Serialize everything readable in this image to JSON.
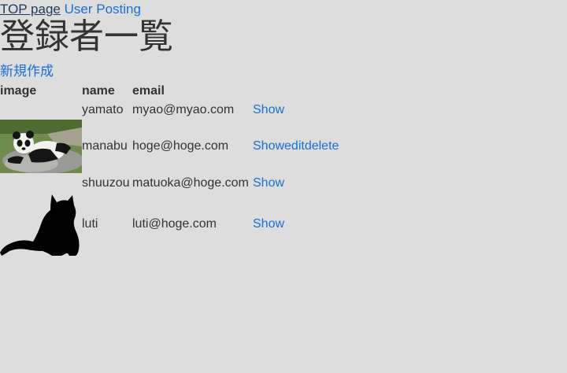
{
  "nav": {
    "top_label": "TOP page",
    "posting_label": "User Posting"
  },
  "page_title": "登録者一覧",
  "new_label": "新規作成",
  "table": {
    "headers": [
      "image",
      "name",
      "email"
    ],
    "rows": [
      {
        "image": "",
        "name": "yamato",
        "email": "myao@myao.com",
        "actions": [
          "Show"
        ]
      },
      {
        "image": "panda-photo",
        "name": "manabu",
        "email": "hoge@hoge.com",
        "actions": [
          "Show",
          "edit",
          "delete"
        ]
      },
      {
        "image": "",
        "name": "shuuzou",
        "email": "matuoka@hoge.com",
        "actions": [
          "Show"
        ]
      },
      {
        "image": "cat-silhouette",
        "name": "luti",
        "email": "luti@hoge.com",
        "actions": [
          "Show"
        ]
      }
    ]
  }
}
